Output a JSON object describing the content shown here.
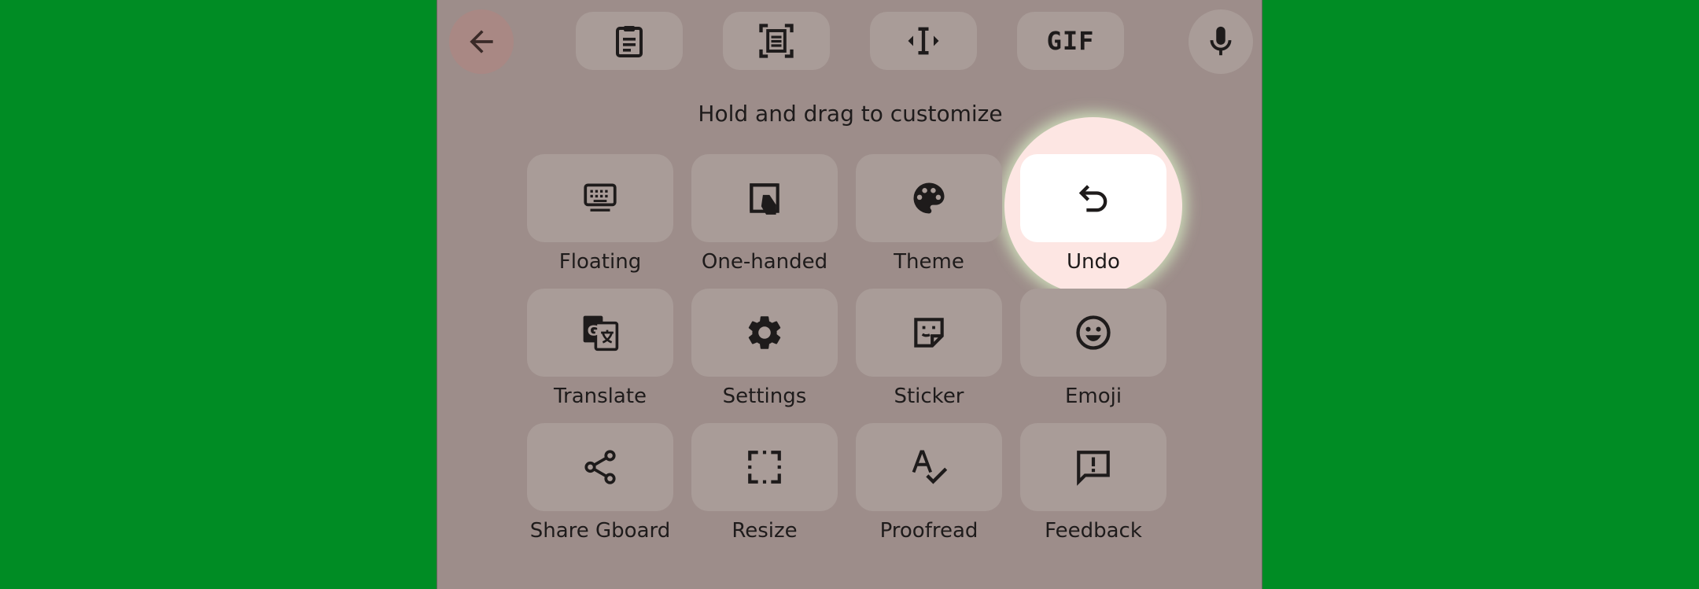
{
  "toolbar": {
    "back": {
      "icon": "arrow-back-icon"
    },
    "items": [
      {
        "name": "clipboard",
        "icon": "clipboard-icon"
      },
      {
        "name": "screenshot",
        "icon": "text-scan-icon"
      },
      {
        "name": "cursor",
        "icon": "cursor-move-icon"
      },
      {
        "name": "gif",
        "icon": "gif-icon",
        "text": "GIF"
      }
    ],
    "mic": {
      "icon": "microphone-icon"
    }
  },
  "hint": "Hold and drag to customize",
  "tiles": [
    {
      "label": "Floating",
      "icon": "keyboard-icon"
    },
    {
      "label": "One-handed",
      "icon": "one-handed-icon"
    },
    {
      "label": "Theme",
      "icon": "palette-icon"
    },
    {
      "label": "Undo",
      "icon": "undo-icon",
      "highlighted": true
    },
    {
      "label": "Translate",
      "icon": "translate-icon"
    },
    {
      "label": "Settings",
      "icon": "gear-icon"
    },
    {
      "label": "Sticker",
      "icon": "sticker-icon"
    },
    {
      "label": "Emoji",
      "icon": "emoji-icon"
    },
    {
      "label": "Share Gboard",
      "icon": "share-icon"
    },
    {
      "label": "Resize",
      "icon": "resize-icon"
    },
    {
      "label": "Proofread",
      "icon": "proofread-icon"
    },
    {
      "label": "Feedback",
      "icon": "feedback-icon"
    }
  ],
  "colors": {
    "background": "#008c24",
    "panel": "#9d8d8a",
    "tile": "#a99c98",
    "highlight": "#fde6e3",
    "back_button": "#a98884",
    "text": "#1e1b1b"
  }
}
